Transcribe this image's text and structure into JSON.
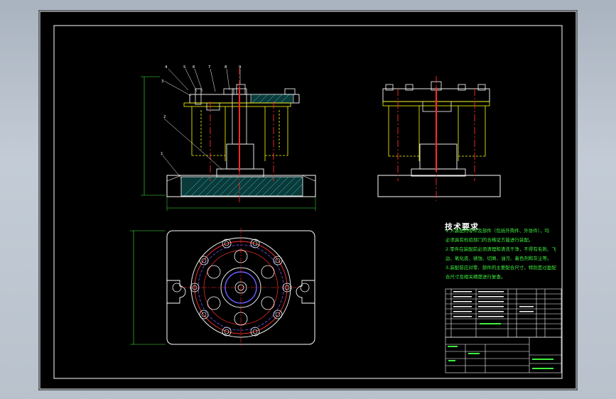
{
  "tech_requirements": {
    "title": "技术要求",
    "lines": [
      "1.入装配的零件及部件（包括外购件、外协件），均",
      "必须具有检验部门的合格证方能进行装配。",
      "2.零件在装配前必须清理和清洗干净，不得有毛刺、飞",
      "边、氧化皮、锈蚀、切屑、油污、着色剂和灰尘等。",
      "3.装配前应对零、部件的主要配合尺寸，特别是过盈配",
      "合尺寸及相关精度进行复查。"
    ]
  },
  "balloons": [
    "4",
    "5",
    "6",
    "7",
    "8",
    "9",
    "3",
    "2",
    "1"
  ],
  "colors": {
    "background": "#000000",
    "outline": "#ffffff",
    "centerline": "#ff2a2a",
    "hidden_line": "#ffff00",
    "hatch": "#46d2d2",
    "dimension": "#3ef03e",
    "circle_detail": "#ff3030",
    "pattern_circle": "#6a5cff"
  }
}
